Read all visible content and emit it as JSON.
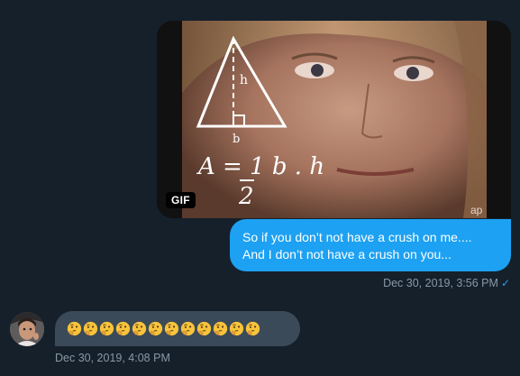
{
  "conversation": {
    "outgoing_media": {
      "badge": "GIF",
      "formula": "A = 1/2 b . h",
      "watermark": "ap"
    },
    "outgoing_message": {
      "line1": "So if you don’t not have a crush on me....",
      "line2": "And I don’t not have a crush on you..."
    },
    "outgoing_meta": {
      "timestamp": "Dec 30, 2019, 3:56 PM",
      "read_mark": "✓"
    },
    "incoming_message": {
      "emoji_count": 12,
      "emoji_icon": "thinking-face-icon"
    },
    "incoming_meta": {
      "timestamp": "Dec 30, 2019, 4:08 PM"
    }
  },
  "colors": {
    "background": "#15202b",
    "outgoing_bubble": "#1da1f2",
    "incoming_bubble": "#3b4a59",
    "meta_text": "#8899a6"
  }
}
